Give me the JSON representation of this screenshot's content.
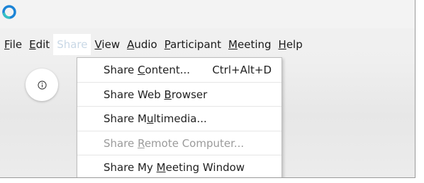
{
  "menubar": {
    "items": [
      {
        "pre": "",
        "u": "F",
        "post": "ile",
        "active": false
      },
      {
        "pre": "",
        "u": "E",
        "post": "dit",
        "active": false
      },
      {
        "pre": "Share",
        "u": "",
        "post": "",
        "active": true
      },
      {
        "pre": "",
        "u": "V",
        "post": "iew",
        "active": false
      },
      {
        "pre": "",
        "u": "A",
        "post": "udio",
        "active": false
      },
      {
        "pre": "",
        "u": "P",
        "post": "articipant",
        "active": false
      },
      {
        "pre": "",
        "u": "M",
        "post": "eeting",
        "active": false
      },
      {
        "pre": "",
        "u": "H",
        "post": "elp",
        "active": false
      }
    ]
  },
  "share_menu": {
    "items": [
      {
        "pre": "Share ",
        "u": "C",
        "post": "ontent...",
        "shortcut": "Ctrl+Alt+D",
        "disabled": false
      },
      {
        "pre": "Share Web ",
        "u": "B",
        "post": "rowser",
        "shortcut": "",
        "disabled": false
      },
      {
        "pre": "Share M",
        "u": "u",
        "post": "ltimedia...",
        "shortcut": "",
        "disabled": false
      },
      {
        "pre": "Share ",
        "u": "R",
        "post": "emote Computer...",
        "shortcut": "",
        "disabled": true
      },
      {
        "pre": "Share My ",
        "u": "M",
        "post": "eeting Window",
        "shortcut": "",
        "disabled": false
      }
    ]
  },
  "icons": {
    "app_logo": "app-logo-icon",
    "info": "info-icon"
  },
  "colors": {
    "active_menu_text": "#c9d8e6",
    "logo_blue": "#1c84d6",
    "logo_teal": "#35c2c4",
    "disabled_text": "#9b9b9b"
  }
}
